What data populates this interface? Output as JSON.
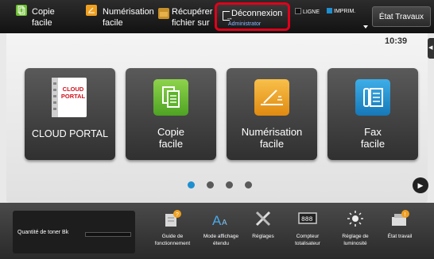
{
  "topbar": {
    "items": [
      {
        "label": "Copie\nfacile",
        "icon": "copy-icon"
      },
      {
        "label": "Numérisation\nfacile",
        "icon": "scan-icon"
      },
      {
        "label": "Récupérer\nfichier sur",
        "icon": "folder-icon"
      }
    ],
    "logout": {
      "label": "Déconnexion",
      "user": "Administrator"
    },
    "status": {
      "line": "LIGNE",
      "print": "IMPRIM."
    },
    "job_status_button": "État Travaux"
  },
  "clock": "10:39",
  "tiles": [
    {
      "label": "CLOUD PORTAL",
      "icon": "cloud-portal-icon",
      "icon_text": "CLOUD\nPORTAL"
    },
    {
      "label": "Copie\nfacile",
      "icon": "copy-icon"
    },
    {
      "label": "Numérisation\nfacile",
      "icon": "scan-icon"
    },
    {
      "label": "Fax\nfacile",
      "icon": "fax-icon"
    }
  ],
  "pagination": {
    "pages": 4,
    "current": 1
  },
  "bottom": {
    "toner_label": "Quantité de toner Bk",
    "toner_level": 1.0,
    "buttons": [
      {
        "label": "Guide de\nfonctionnement",
        "icon": "guide-icon"
      },
      {
        "label": "Mode affichage\nétendu",
        "icon": "display-mode-icon"
      },
      {
        "label": "Réglages",
        "icon": "settings-icon"
      },
      {
        "label": "Compteur\ntotalisateur",
        "icon": "counter-icon"
      },
      {
        "label": "Réglage de\nluminosité",
        "icon": "brightness-icon"
      },
      {
        "label": "État travail",
        "icon": "job-status-icon"
      }
    ]
  },
  "colors": {
    "highlight": "#e0001b",
    "copy": "#6cbf2f",
    "scan": "#f0a020",
    "fax": "#1e8fd0"
  }
}
